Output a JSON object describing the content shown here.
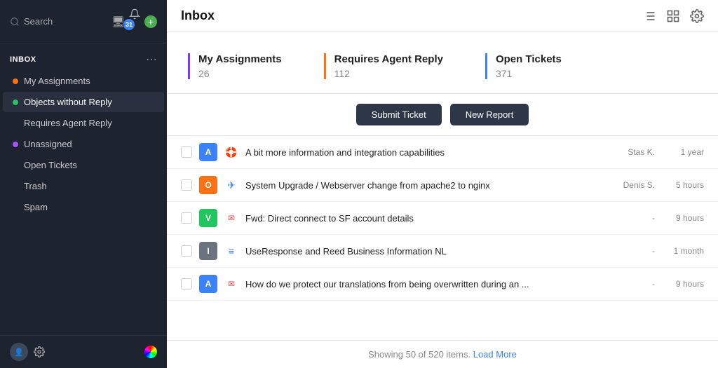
{
  "sidebar": {
    "search_placeholder": "Search",
    "notification_count": "31",
    "inbox_label": "INBOX",
    "nav_items": [
      {
        "label": "My Assignments",
        "dot": "orange",
        "active": false
      },
      {
        "label": "Objects without Reply",
        "dot": "green",
        "active": true
      },
      {
        "label": "Requires Agent Reply",
        "dot": null,
        "active": false
      },
      {
        "label": "Unassigned",
        "dot": "purple",
        "active": false
      },
      {
        "label": "Open Tickets",
        "dot": null,
        "active": false
      },
      {
        "label": "Trash",
        "dot": null,
        "active": false
      },
      {
        "label": "Spam",
        "dot": null,
        "active": false
      }
    ],
    "more_dots": "···"
  },
  "main": {
    "title": "Inbox",
    "stats": [
      {
        "label": "My Assignments",
        "value": "26",
        "color": "purple"
      },
      {
        "label": "Requires Agent Reply",
        "value": "112",
        "color": "orange"
      },
      {
        "label": "Open Tickets",
        "value": "371",
        "color": "blue"
      }
    ],
    "buttons": [
      {
        "label": "Submit Ticket",
        "key": "submit-ticket"
      },
      {
        "label": "New Report",
        "key": "new-report"
      }
    ],
    "tickets": [
      {
        "avatar": "A",
        "avatar_color": "#3b82f6",
        "type_icon": "🛟",
        "type_color": "#e5e7eb",
        "subject": "A bit more information and integration capabilities",
        "assignee": "Stas K.",
        "time": "1 year"
      },
      {
        "avatar": "O",
        "avatar_color": "#f97316",
        "type_icon": "✈",
        "type_color": "#3b82f6",
        "subject": "System Upgrade / Webserver change from apache2 to nginx",
        "assignee": "Denis S.",
        "time": "5 hours"
      },
      {
        "avatar": "V",
        "avatar_color": "#22c55e",
        "type_icon": "✉",
        "type_color": "#ef4444",
        "subject": "Fwd: Direct connect to SF account details",
        "assignee": "-",
        "time": "9 hours"
      },
      {
        "avatar": "I",
        "avatar_color": "#6b7280",
        "type_icon": "≡",
        "type_color": "#3b82f6",
        "subject": "UseResponse and Reed Business Information NL",
        "assignee": "-",
        "time": "1 month"
      },
      {
        "avatar": "A",
        "avatar_color": "#3b82f6",
        "type_icon": "✉",
        "type_color": "#ef4444",
        "subject": "How do we protect our translations from being overwritten during an ...",
        "assignee": "-",
        "time": "9 hours"
      }
    ],
    "footer_text": "Showing 50 of 520 items.",
    "load_more_text": "Load More"
  }
}
